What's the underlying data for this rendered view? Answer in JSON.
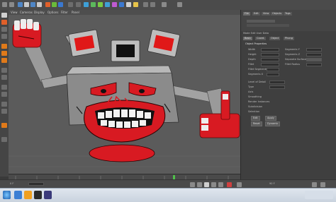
{
  "app": {
    "viewport_menu": [
      "View",
      "Cameras",
      "Display",
      "Options",
      "Filter",
      "Panel"
    ],
    "object_manager": {
      "tabs": [
        "File",
        "Edit",
        "View",
        "Objects",
        "Tags"
      ]
    },
    "attributes": {
      "header": "Mode  Edit  User Data",
      "tabs": [
        "Basic",
        "Coord.",
        "Object",
        "Phong"
      ],
      "section_title": "Object Properties",
      "fields_left": [
        "Width",
        "Height",
        "Depth",
        "Fillet",
        "Fillet Segments",
        "Segments X"
      ],
      "fields_right": [
        "Segments Y",
        "Segments Z",
        "Separate Surfaces",
        "Fillet Radius",
        "",
        ""
      ],
      "extra_labels": [
        "Level of Detail",
        "Type",
        "Axis",
        "Smoothing",
        "Render Instances",
        "Subdivision",
        "Selection"
      ],
      "buttons": [
        "Edit",
        "Apply",
        "Reset",
        "Dynamic"
      ]
    },
    "timeline": {
      "frame_start": "0 F",
      "frame_end": "90 F"
    }
  },
  "colors": {
    "robot_red": "#d81a22",
    "robot_grey": "#8b8b8b",
    "accent_orange": "#e07a1a"
  },
  "icons": [
    "move-icon",
    "scale-icon",
    "rotate-icon",
    "cube-icon",
    "render-icon",
    "camera-icon",
    "light-icon"
  ]
}
